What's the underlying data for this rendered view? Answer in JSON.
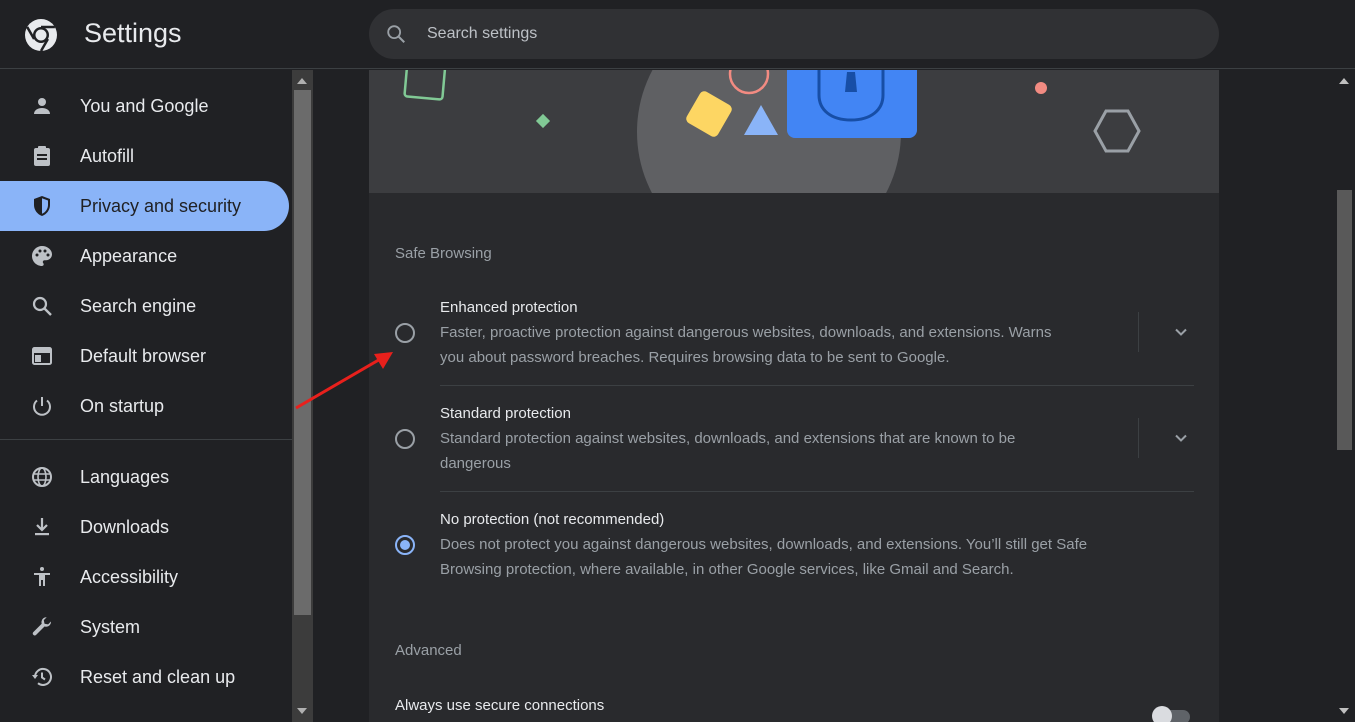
{
  "header": {
    "title": "Settings",
    "search_placeholder": "Search settings"
  },
  "sidebar": {
    "items": [
      {
        "label": "You and Google",
        "icon": "person-icon"
      },
      {
        "label": "Autofill",
        "icon": "clipboard-icon"
      },
      {
        "label": "Privacy and security",
        "icon": "shield-icon",
        "active": true
      },
      {
        "label": "Appearance",
        "icon": "palette-icon"
      },
      {
        "label": "Search engine",
        "icon": "search-icon"
      },
      {
        "label": "Default browser",
        "icon": "browser-window-icon"
      },
      {
        "label": "On startup",
        "icon": "power-icon"
      },
      {
        "label": "Languages",
        "icon": "globe-icon"
      },
      {
        "label": "Downloads",
        "icon": "download-icon"
      },
      {
        "label": "Accessibility",
        "icon": "accessibility-icon"
      },
      {
        "label": "System",
        "icon": "wrench-icon"
      },
      {
        "label": "Reset and clean up",
        "icon": "restore-icon"
      }
    ]
  },
  "safe_browsing": {
    "section_title": "Safe Browsing",
    "options": [
      {
        "title": "Enhanced protection",
        "desc_line1": "Faster, proactive protection against dangerous websites, downloads, and extensions. Warns",
        "desc_line2": "you about password breaches. Requires browsing data to be sent to Google.",
        "selected": false,
        "expandable": true
      },
      {
        "title": "Standard protection",
        "desc_line1": "Standard protection against websites, downloads, and extensions that are known to be",
        "desc_line2": "dangerous",
        "selected": false,
        "expandable": true
      },
      {
        "title": "No protection (not recommended)",
        "desc_line1": "Does not protect you against dangerous websites, downloads, and extensions. You’ll still get Safe",
        "desc_line2": "Browsing protection, where available, in other Google services, like Gmail and Search.",
        "selected": true,
        "expandable": false
      }
    ]
  },
  "advanced": {
    "section_title": "Advanced",
    "secure_connections_label": "Always use secure connections",
    "secure_connections_enabled": false
  },
  "colors": {
    "accent": "#8ab4f8",
    "background": "#202124",
    "card": "#292a2d",
    "annotation_arrow": "#e8201c"
  }
}
